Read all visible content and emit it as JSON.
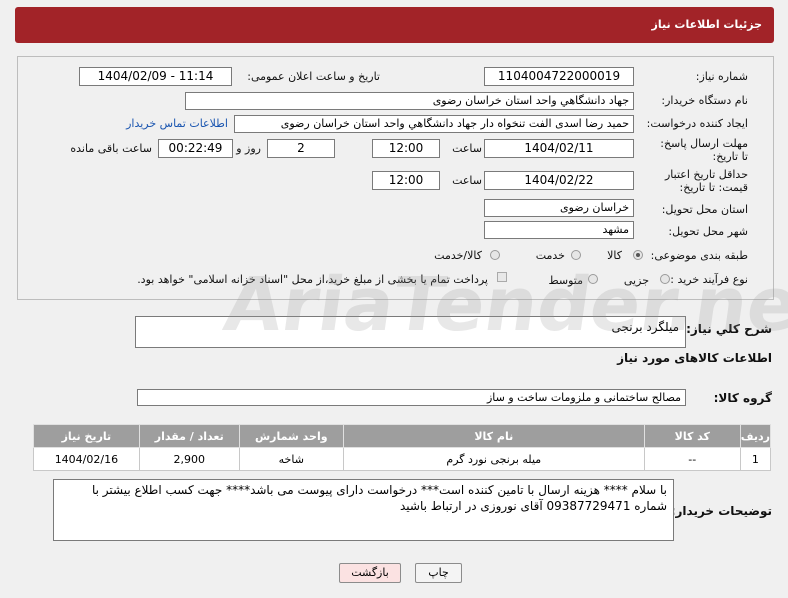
{
  "header": {
    "title": "جزئیات اطلاعات نیاز"
  },
  "fields": {
    "need_number_label": "شماره نیاز:",
    "need_number": "1104004722000019",
    "announce_label": "تاریخ و ساعت اعلان عمومی:",
    "announce_value": "1404/02/09 - 11:14",
    "buyer_org_label": "نام دستگاه خریدار:",
    "buyer_org": "جهاد دانشگاهي واحد استان خراسان رضوی",
    "requester_label": "ایجاد کننده درخواست:",
    "requester": "حمید رضا اسدی الفت تنخواه دار جهاد دانشگاهي واحد استان خراسان رضوی",
    "contact_link": "اطلاعات تماس خریدار",
    "reply_deadline_label": "مهلت ارسال پاسخ: تا تاریخ:",
    "reply_date": "1404/02/11",
    "time_label": "ساعت",
    "reply_time": "12:00",
    "days_value": "2",
    "days_label": "روز و",
    "remaining_time": "00:22:49",
    "remaining_label": "ساعت باقی مانده",
    "price_validity_label": "حداقل تاریخ اعتبار قیمت: تا تاریخ:",
    "price_date": "1404/02/22",
    "price_time": "12:00",
    "delivery_province_label": "استان محل تحویل:",
    "delivery_province": "خراسان رضوی",
    "delivery_city_label": "شهر محل تحویل:",
    "delivery_city": "مشهد",
    "category_label": "طبقه بندی موضوعی:",
    "category_options": [
      "کالا",
      "خدمت",
      "کالا/خدمت"
    ],
    "process_label": "نوع فرآیند خرید :",
    "process_options": [
      "جزیی",
      "متوسط"
    ],
    "payment_note": "پرداخت تمام یا بخشی از مبلغ خرید،از محل \"اسناد خزانه اسلامی\" خواهد بود."
  },
  "summary": {
    "label": "شرح کلي نياز:",
    "value": "میلگرد برنجی"
  },
  "goods_section": {
    "title": "اطلاعات کالاهای مورد نیاز",
    "group_label": "گروه کالا:",
    "group_value": "مصالح ساختمانی و ملزومات ساخت و ساز"
  },
  "table": {
    "headers": [
      "ردیف",
      "کد کالا",
      "نام کالا",
      "واحد شمارش",
      "تعداد / مقدار",
      "تاریخ نیاز"
    ],
    "rows": [
      [
        "1",
        "--",
        "میله برنجی نورد گرم",
        "شاخه",
        "2,900",
        "1404/02/16"
      ]
    ]
  },
  "buyer_notes": {
    "label": "توضیحات خریدار:",
    "text": "با سلام **** هزینه ارسال با تامین کننده است*** درخواست دارای پیوست می باشد**** جهت کسب اطلاع بیشتر با شماره 09387729471 آقای نوروزی در ارتباط باشید"
  },
  "buttons": {
    "print": "چاپ",
    "back": "بازگشت"
  },
  "watermark": "AriaTender.neT",
  "colors": {
    "header": "#a22328",
    "table_header": "#9e9e9e",
    "link": "#1a55b0"
  }
}
